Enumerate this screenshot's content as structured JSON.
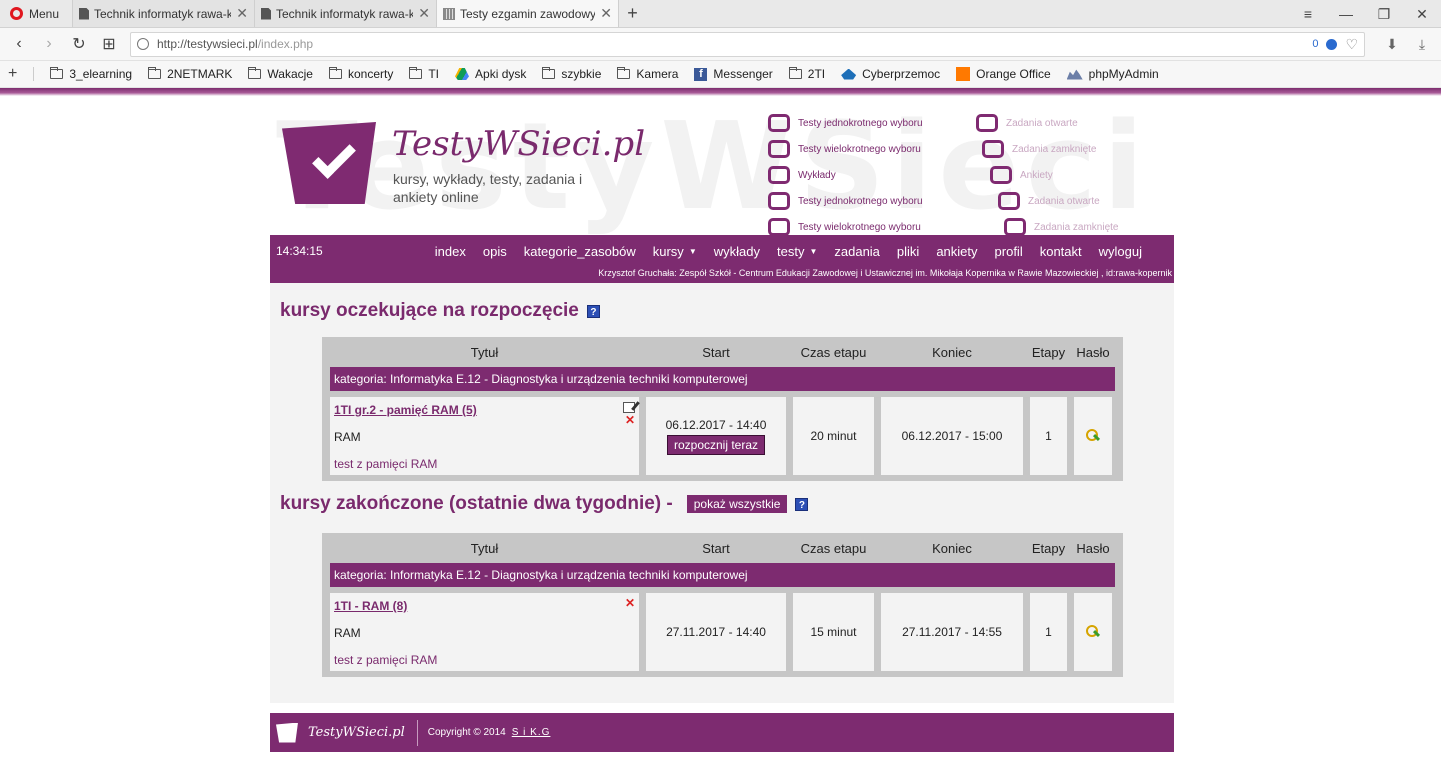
{
  "browser": {
    "menu_label": "Menu",
    "tabs": [
      {
        "title": "Technik informatyk rawa-k",
        "active": false
      },
      {
        "title": "Technik informatyk rawa-k",
        "active": false
      },
      {
        "title": "Testy ezgamin zawodowy",
        "active": true
      }
    ],
    "url_host": "http://testywsieci.pl",
    "url_path": "/index.php",
    "adblock_count": "0",
    "bookmarks": [
      {
        "label": "3_elearning",
        "icon": "folder-icon"
      },
      {
        "label": "2NETMARK",
        "icon": "folder-icon"
      },
      {
        "label": "Wakacje",
        "icon": "folder-icon"
      },
      {
        "label": "koncerty",
        "icon": "folder-icon"
      },
      {
        "label": "TI",
        "icon": "folder-icon"
      },
      {
        "label": "Apki dysk",
        "icon": "drive-icon"
      },
      {
        "label": "szybkie",
        "icon": "folder-icon"
      },
      {
        "label": "Kamera",
        "icon": "folder-icon"
      },
      {
        "label": "Messenger",
        "icon": "facebook-icon"
      },
      {
        "label": "2TI",
        "icon": "folder-icon"
      },
      {
        "label": "Cyberprzemoc",
        "icon": "cyber-icon"
      },
      {
        "label": "Orange Office",
        "icon": "orange-icon"
      },
      {
        "label": "phpMyAdmin",
        "icon": "phpmyadmin-icon"
      }
    ]
  },
  "site": {
    "logo_title": "TestyWSieci.pl",
    "logo_subtitle": "kursy, wykłady, testy, zadania i ankiety online",
    "watermark": "TestyWSieci",
    "features_left": [
      "Testy jednokrotnego wyboru",
      "Testy wielokrotnego wyboru",
      "Wykłady",
      "Testy jednokrotnego wyboru",
      "Testy wielokrotnego wyboru"
    ],
    "features_right": [
      "Zadania otwarte",
      "Zadania zamknięte",
      "Ankiety",
      "Zadania otwarte",
      "Zadania zamknięte"
    ],
    "clock": "14:34:15",
    "menu": [
      {
        "label": "index",
        "has_caret": false
      },
      {
        "label": "opis",
        "has_caret": false
      },
      {
        "label": "kategorie_zasobów",
        "has_caret": false
      },
      {
        "label": "kursy",
        "has_caret": true
      },
      {
        "label": "wykłady",
        "has_caret": false
      },
      {
        "label": "testy",
        "has_caret": true
      },
      {
        "label": "zadania",
        "has_caret": false
      },
      {
        "label": "pliki",
        "has_caret": false
      },
      {
        "label": "ankiety",
        "has_caret": false
      },
      {
        "label": "profil",
        "has_caret": false
      },
      {
        "label": "kontakt",
        "has_caret": false
      },
      {
        "label": "wyloguj",
        "has_caret": false
      }
    ],
    "user_line": "Krzysztof Gruchała: Zespół Szkół - Centrum Edukacji Zawodowej i Ustawicznej im. Mikołaja Kopernika w Rawie Mazowieckiej , id:rawa-kopernik",
    "table_headers": {
      "title": "Tytuł",
      "start": "Start",
      "duration": "Czas etapu",
      "end": "Koniec",
      "stages": "Etapy",
      "password": "Hasło"
    },
    "pending": {
      "heading": "kursy oczekujące na rozpoczęcie",
      "category": "kategoria: Informatyka E.12 - Diagnostyka i urządzenia techniki komputerowej",
      "course": {
        "title": "1TI gr.2 - pamięć RAM (5)",
        "subject": "RAM",
        "description": "test z pamięci RAM",
        "start": "06.12.2017 - 14:40",
        "start_now_label": "rozpocznij teraz",
        "duration": "20 minut",
        "end": "06.12.2017 - 15:00",
        "stages": "1"
      }
    },
    "finished": {
      "heading": "kursy zakończone (ostatnie dwa tygodnie) -",
      "show_all_label": "pokaż wszystkie",
      "category": "kategoria: Informatyka E.12 - Diagnostyka i urządzenia techniki komputerowej",
      "course": {
        "title": "1TI - RAM (8)",
        "subject": "RAM",
        "description": "test z pamięci RAM",
        "start": "27.11.2017 - 14:40",
        "duration": "15 minut",
        "end": "27.11.2017 - 14:55",
        "stages": "1"
      }
    },
    "footer": {
      "logo_text": "TestyWSieci.pl",
      "copyright": "Copyright © 2014",
      "author_link": "S i K.G"
    }
  },
  "colors": {
    "brand": "#7d2b70",
    "content_bg": "#f3f3f3",
    "table_bg": "#c6c6c6"
  }
}
